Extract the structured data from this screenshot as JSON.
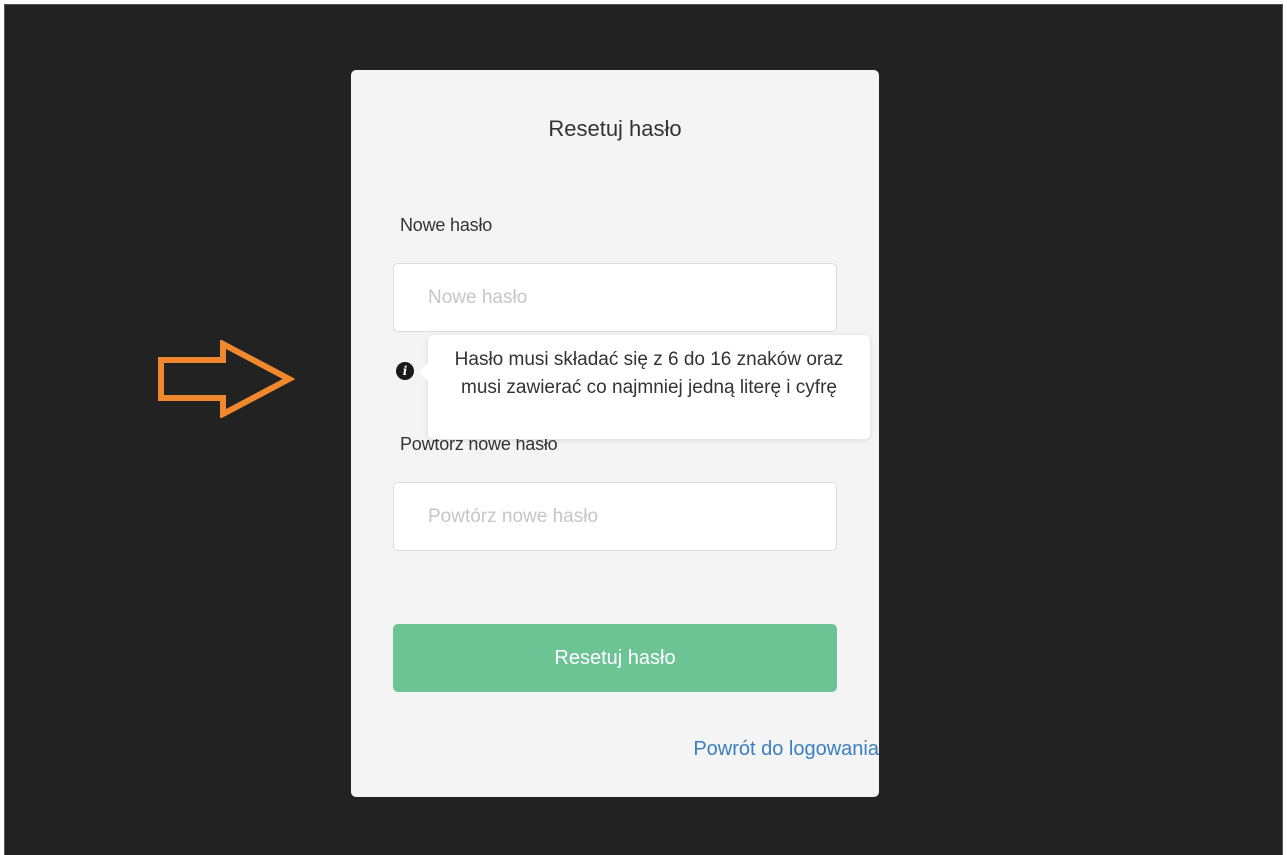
{
  "card": {
    "title": "Resetuj hasło"
  },
  "new_password": {
    "label": "Nowe hasło",
    "placeholder": "Nowe hasło",
    "value": ""
  },
  "tooltip": {
    "text": "Hasło musi składać się z 6 do 16 znaków oraz musi zawierać co najmniej jedną literę i cyfrę"
  },
  "repeat_password": {
    "label": "Powtórz nowe hasło",
    "placeholder": "Powtórz nowe hasło",
    "value": ""
  },
  "submit": {
    "label": "Resetuj hasło"
  },
  "back_link": {
    "label": "Powrót do logowania"
  },
  "icons": {
    "info": "info-circle-icon",
    "annotation": "arrow-right-outline-icon"
  },
  "colors": {
    "background": "#222222",
    "card": "#f4f4f4",
    "button": "#6cc495",
    "link": "#3b7fc0",
    "annotation_arrow": "#f0892d"
  }
}
